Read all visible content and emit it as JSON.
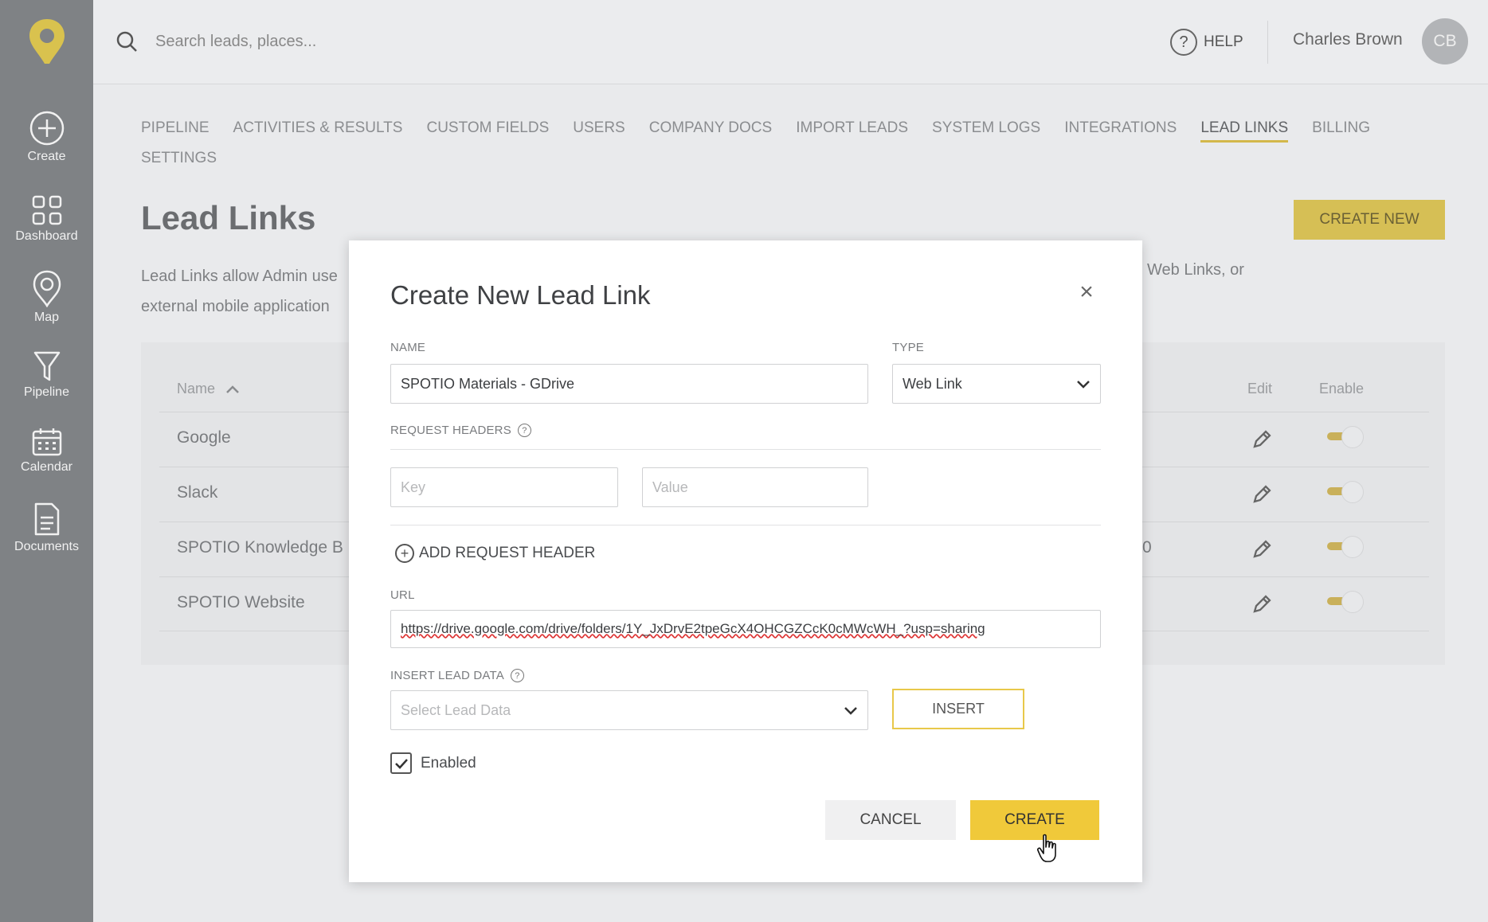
{
  "sidebar": {
    "items": [
      {
        "label": "Create",
        "icon": "plus-circle-icon"
      },
      {
        "label": "Dashboard",
        "icon": "grid-icon"
      },
      {
        "label": "Map",
        "icon": "map-pin-icon"
      },
      {
        "label": "Pipeline",
        "icon": "funnel-icon"
      },
      {
        "label": "Calendar",
        "icon": "calendar-icon"
      },
      {
        "label": "Documents",
        "icon": "document-icon"
      }
    ]
  },
  "topbar": {
    "search_placeholder": "Search leads, places...",
    "help_label": "HELP",
    "help_glyph": "?",
    "user_name": "Charles Brown",
    "user_initials": "CB"
  },
  "nav": {
    "row1": [
      "PIPELINE",
      "ACTIVITIES & RESULTS",
      "CUSTOM FIELDS",
      "USERS",
      "COMPANY DOCS",
      "IMPORT LEADS",
      "SYSTEM LOGS",
      "INTEGRATIONS",
      "LEAD LINKS",
      "BILLING"
    ],
    "row2": [
      "SETTINGS"
    ],
    "active": "LEAD LINKS"
  },
  "page": {
    "title": "Lead Links",
    "create_new": "CREATE NEW",
    "desc_line1": "Lead Links allow Admin use",
    "desc_line2": "external mobile application",
    "desc_right": "Web Links, or"
  },
  "table": {
    "columns": {
      "name": "Name",
      "edit": "Edit",
      "enable": "Enable"
    },
    "rows": [
      {
        "name": "Google",
        "extra": "",
        "enabled": true
      },
      {
        "name": "Slack",
        "extra": "",
        "enabled": true
      },
      {
        "name": "SPOTIO Knowledge B",
        "extra": "0",
        "enabled": true
      },
      {
        "name": "SPOTIO Website",
        "extra": "",
        "enabled": true
      }
    ]
  },
  "modal": {
    "title": "Create New Lead Link",
    "close_glyph": "×",
    "name_label": "NAME",
    "name_value": "SPOTIO Materials - GDrive",
    "type_label": "TYPE",
    "type_value": "Web Link",
    "request_headers_label": "REQUEST HEADERS",
    "key_placeholder": "Key",
    "value_placeholder": "Value",
    "add_request_header": "ADD REQUEST HEADER",
    "url_label": "URL",
    "url_value": "https://drive.google.com/drive/folders/1Y_JxDrvE2tpeGcX4OHCGZCcK0cMWcWH_?usp=sharing",
    "insert_lead_data_label": "INSERT LEAD DATA",
    "select_lead_data_placeholder": "Select Lead Data",
    "insert_button": "INSERT",
    "enabled_label": "Enabled",
    "enabled": true,
    "cancel_button": "CANCEL",
    "create_button": "CREATE"
  },
  "colors": {
    "accent_yellow": "#f0c93a",
    "sidebar_bg": "#7f8285"
  }
}
